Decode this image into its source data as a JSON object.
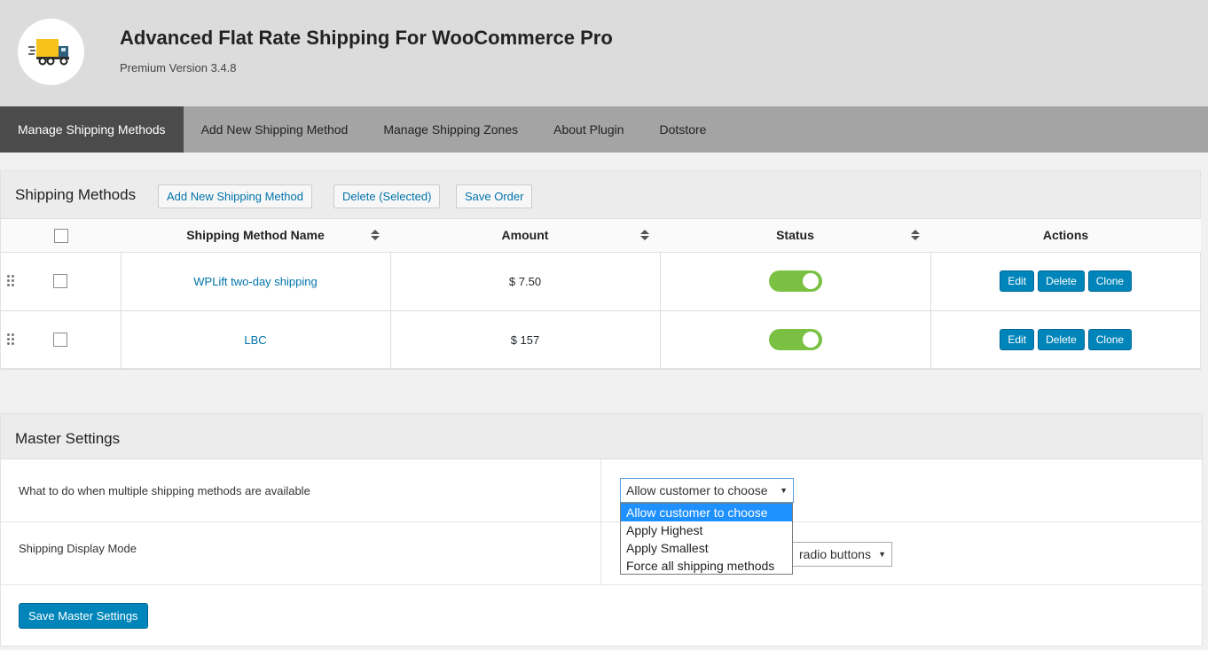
{
  "header": {
    "title": "Advanced Flat Rate Shipping For WooCommerce Pro",
    "version": "Premium Version 3.4.8",
    "logo_icon": "delivery-truck-icon"
  },
  "nav": {
    "items": [
      "Manage Shipping Methods",
      "Add New Shipping Method",
      "Manage Shipping Zones",
      "About Plugin",
      "Dotstore"
    ],
    "active": "Manage Shipping Methods"
  },
  "shipping_methods": {
    "title": "Shipping Methods",
    "add_label": "Add New Shipping Method",
    "delete_label": "Delete (Selected)",
    "save_order_label": "Save Order",
    "columns": {
      "name": "Shipping Method Name",
      "amount": "Amount",
      "status": "Status",
      "actions": "Actions"
    },
    "rows": [
      {
        "name": "WPLift two-day shipping",
        "amount": "$ 7.50",
        "enabled": true
      },
      {
        "name": "LBC",
        "amount": "$ 157",
        "enabled": true
      }
    ],
    "actions": {
      "edit": "Edit",
      "delete": "Delete",
      "clone": "Clone"
    }
  },
  "master_settings": {
    "title": "Master Settings",
    "multiple_label": "What to do when multiple shipping methods are available",
    "multiple_value": "Allow customer to choose",
    "display_label": "Shipping Display Mode",
    "display_value_visible": "radio buttons",
    "options": [
      "Allow customer to choose",
      "Apply Highest",
      "Apply Smallest",
      "Force all shipping methods"
    ],
    "save_label": "Save Master Settings"
  },
  "colors": {
    "accent": "#0085ba",
    "toggle_on": "#7ac143",
    "nav_active": "#4b4b4b"
  }
}
